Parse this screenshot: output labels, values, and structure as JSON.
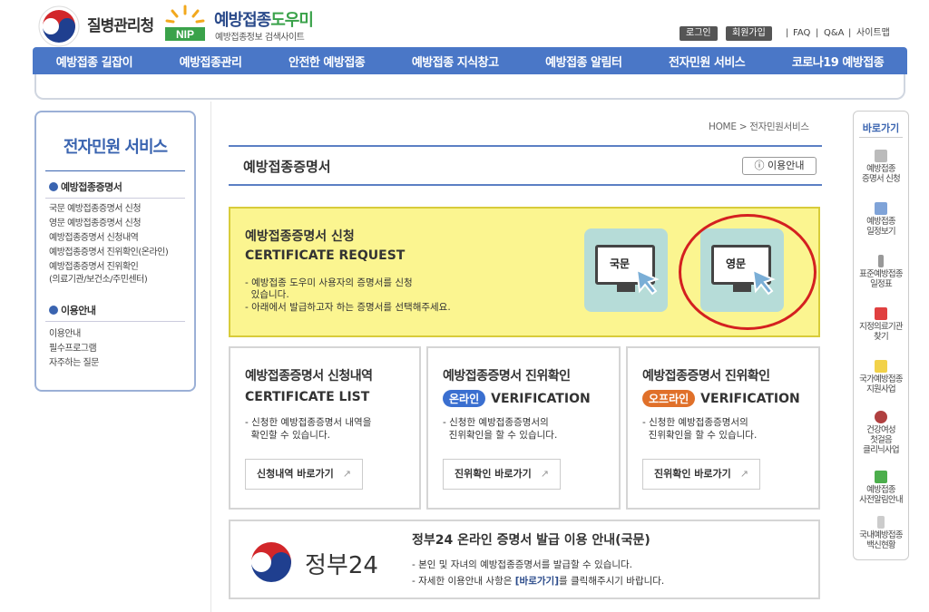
{
  "header": {
    "org_name": "질병관리청",
    "site_title_a": "예방접종",
    "site_title_b": "도우미",
    "site_sub": "예방접종정보 검색사이트",
    "nip_label": "NIP",
    "util": {
      "login": "로그인",
      "join": "회원가입",
      "faq": "FAQ",
      "qa": "Q&A",
      "sitemap": "사이트맵"
    }
  },
  "nav": [
    "예방접종 길잡이",
    "예방접종관리",
    "안전한 예방접종",
    "예방접종 지식창고",
    "예방접종 알림터",
    "전자민원 서비스",
    "코로나19 예방접종"
  ],
  "sidebar": {
    "title": "전자민원 서비스",
    "sec1": "예방접종증명서",
    "items1": [
      "국문 예방접종증명서 신청",
      "영문 예방접종증명서 신청",
      "예방접종증명서 신청내역",
      "예방접종증명서 진위확인(온라인)",
      "예방접종증명서 진위확인",
      "(의료기관/보건소/주민센터)"
    ],
    "sec2": "이용안내",
    "items2": [
      "이용안내",
      "필수프로그램",
      "자주하는 질문"
    ]
  },
  "breadcrumb": "HOME > 전자민원서비스",
  "page_title": "예방접종증명서",
  "guide_button": "이용안내",
  "request": {
    "title_ko": "예방접종증명서 신청",
    "title_en": "CERTIFICATE REQUEST",
    "desc": [
      "- 예방접종 도우미 사용자의 증명서를 신청",
      "  있습니다.",
      "- 아래에서 발급하고자 하는 증명서를 선택해주세요."
    ],
    "btn_ko": "국문",
    "btn_en": "영문"
  },
  "boxes": [
    {
      "title": "예방접종증명서 신청내역",
      "sub": "CERTIFICATE LIST",
      "pill": "",
      "desc": [
        "- 신청한 예방접종증명서 내역을",
        "  확인할 수 있습니다."
      ],
      "link": "신청내역 바로가기"
    },
    {
      "title": "예방접종증명서 진위확인",
      "sub": "VERIFICATION",
      "pill": "온라인",
      "desc": [
        "- 신청한 예방접종증명서의",
        "  진위확인을 할 수 있습니다."
      ],
      "link": "진위확인 바로가기"
    },
    {
      "title": "예방접종증명서 진위확인",
      "sub": "VERIFICATION",
      "pill": "오프라인",
      "desc": [
        "- 신청한 예방접종증명서의",
        "  진위확인을 할 수 있습니다."
      ],
      "link": "진위확인 바로가기"
    }
  ],
  "gov24": {
    "logo_text": "정부24",
    "title": "정부24 온라인 증명서 발급 이용 안내(국문)",
    "desc1": "- 본인 및 자녀의 예방접종증명서를 발급할 수 있습니다.",
    "desc2a": "- 자세한 이용안내 사항은 ",
    "desc2b": "[바로가기]",
    "desc2c": "를 클릭해주시기 바랍니다."
  },
  "quick": {
    "title": "바로가기",
    "items": [
      [
        "예방접종",
        "증명서 신청"
      ],
      [
        "예방접종",
        "일정보기"
      ],
      [
        "표준예방접종",
        "일정표"
      ],
      [
        "지정의료기관",
        "찾기"
      ],
      [
        "국가예방접종",
        "지원사업"
      ],
      [
        "건강여성",
        "첫걸음",
        "클리닉사업"
      ],
      [
        "예방접종",
        "사전알림안내"
      ],
      [
        "국내예방접종",
        "백신현황"
      ]
    ]
  },
  "colors": {
    "nav": "#4a77c7",
    "online_pill": "#3a6fd0",
    "offline_pill": "#e0702a",
    "request_bg": "#fbf590",
    "highlight_ring": "#d42020"
  }
}
